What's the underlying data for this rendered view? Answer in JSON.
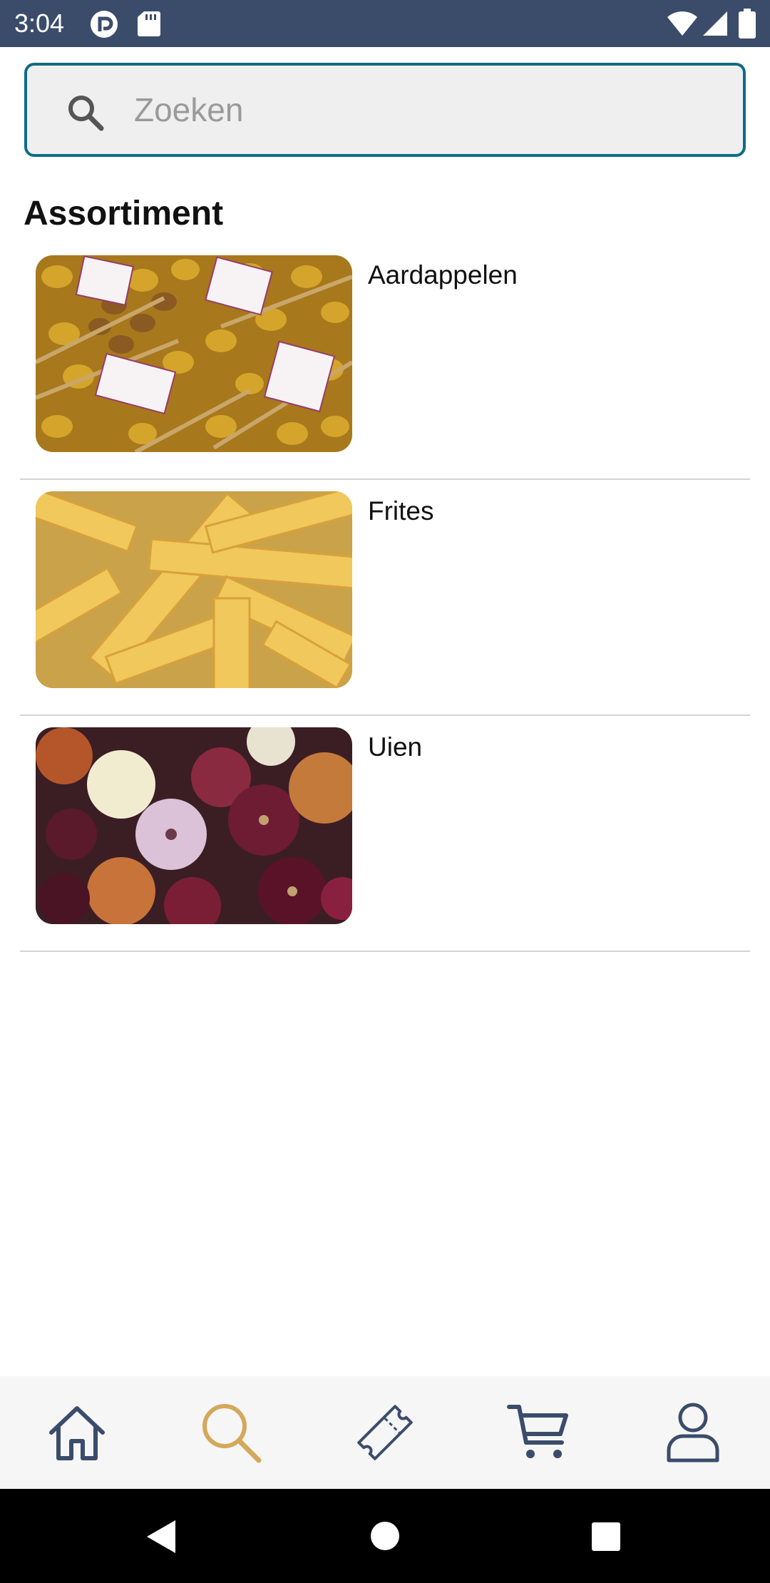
{
  "status_bar": {
    "time": "3:04",
    "icons": [
      "pocket-casts-icon",
      "sd-card-icon",
      "wifi-icon",
      "signal-icon",
      "battery-icon"
    ]
  },
  "search": {
    "placeholder": "Zoeken",
    "value": ""
  },
  "section": {
    "title": "Assortiment"
  },
  "products": [
    {
      "label": "Aardappelen",
      "image": "potatoes-photo"
    },
    {
      "label": "Frites",
      "image": "fries-photo"
    },
    {
      "label": "Uien",
      "image": "onions-photo"
    }
  ],
  "bottom_nav": {
    "items": [
      {
        "icon": "home-icon",
        "active": false
      },
      {
        "icon": "search-icon",
        "active": true
      },
      {
        "icon": "ticket-icon",
        "active": false
      },
      {
        "icon": "cart-icon",
        "active": false
      },
      {
        "icon": "profile-icon",
        "active": false
      }
    ],
    "active_color": "#d4a85a",
    "inactive_color": "#3b4c6b"
  },
  "colors": {
    "status_bar": "#3b4c6b",
    "search_border": "#0f6b86"
  }
}
